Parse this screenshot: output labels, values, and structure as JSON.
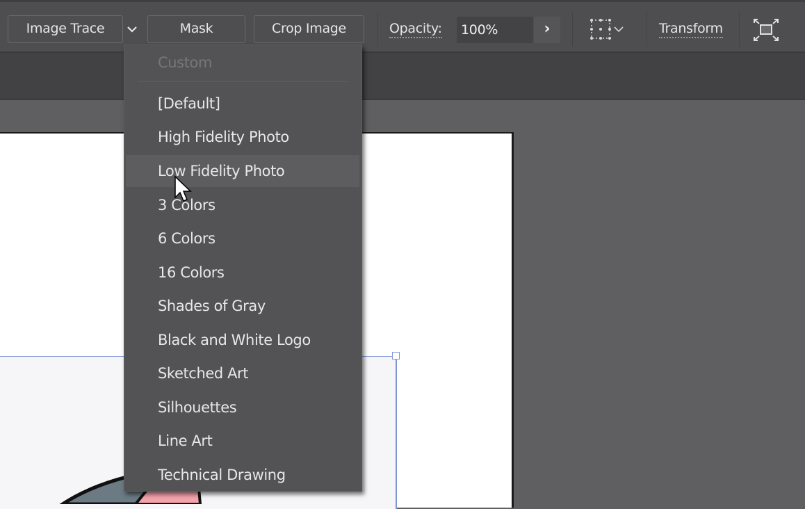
{
  "control_bar": {
    "image_trace_label": "Image Trace",
    "trace_presets_chevron": "chevron-down-icon",
    "mask_label": "Mask",
    "crop_image_label": "Crop Image",
    "opacity_label": "Opacity:",
    "opacity_value": "100%",
    "opacity_arrow": "›",
    "align_icon": "align-to-selection-icon",
    "transform_label": "Transform",
    "isolate_icon": "isolate-object-icon"
  },
  "trace_presets_menu": {
    "items": [
      {
        "label": "Custom",
        "disabled": true
      },
      {
        "label": "[Default]"
      },
      {
        "label": "High Fidelity Photo"
      },
      {
        "label": "Low Fidelity Photo",
        "hovered": true
      },
      {
        "label": "3 Colors"
      },
      {
        "label": "6 Colors"
      },
      {
        "label": "16 Colors"
      },
      {
        "label": "Shades of Gray"
      },
      {
        "label": "Black and White Logo"
      },
      {
        "label": "Sketched Art"
      },
      {
        "label": "Silhouettes"
      },
      {
        "label": "Line Art"
      },
      {
        "label": "Technical Drawing"
      }
    ]
  },
  "colors": {
    "selection_blue": "#7e95d6",
    "art_gray": "#6b7a83",
    "art_pink": "#f5a3ad"
  }
}
